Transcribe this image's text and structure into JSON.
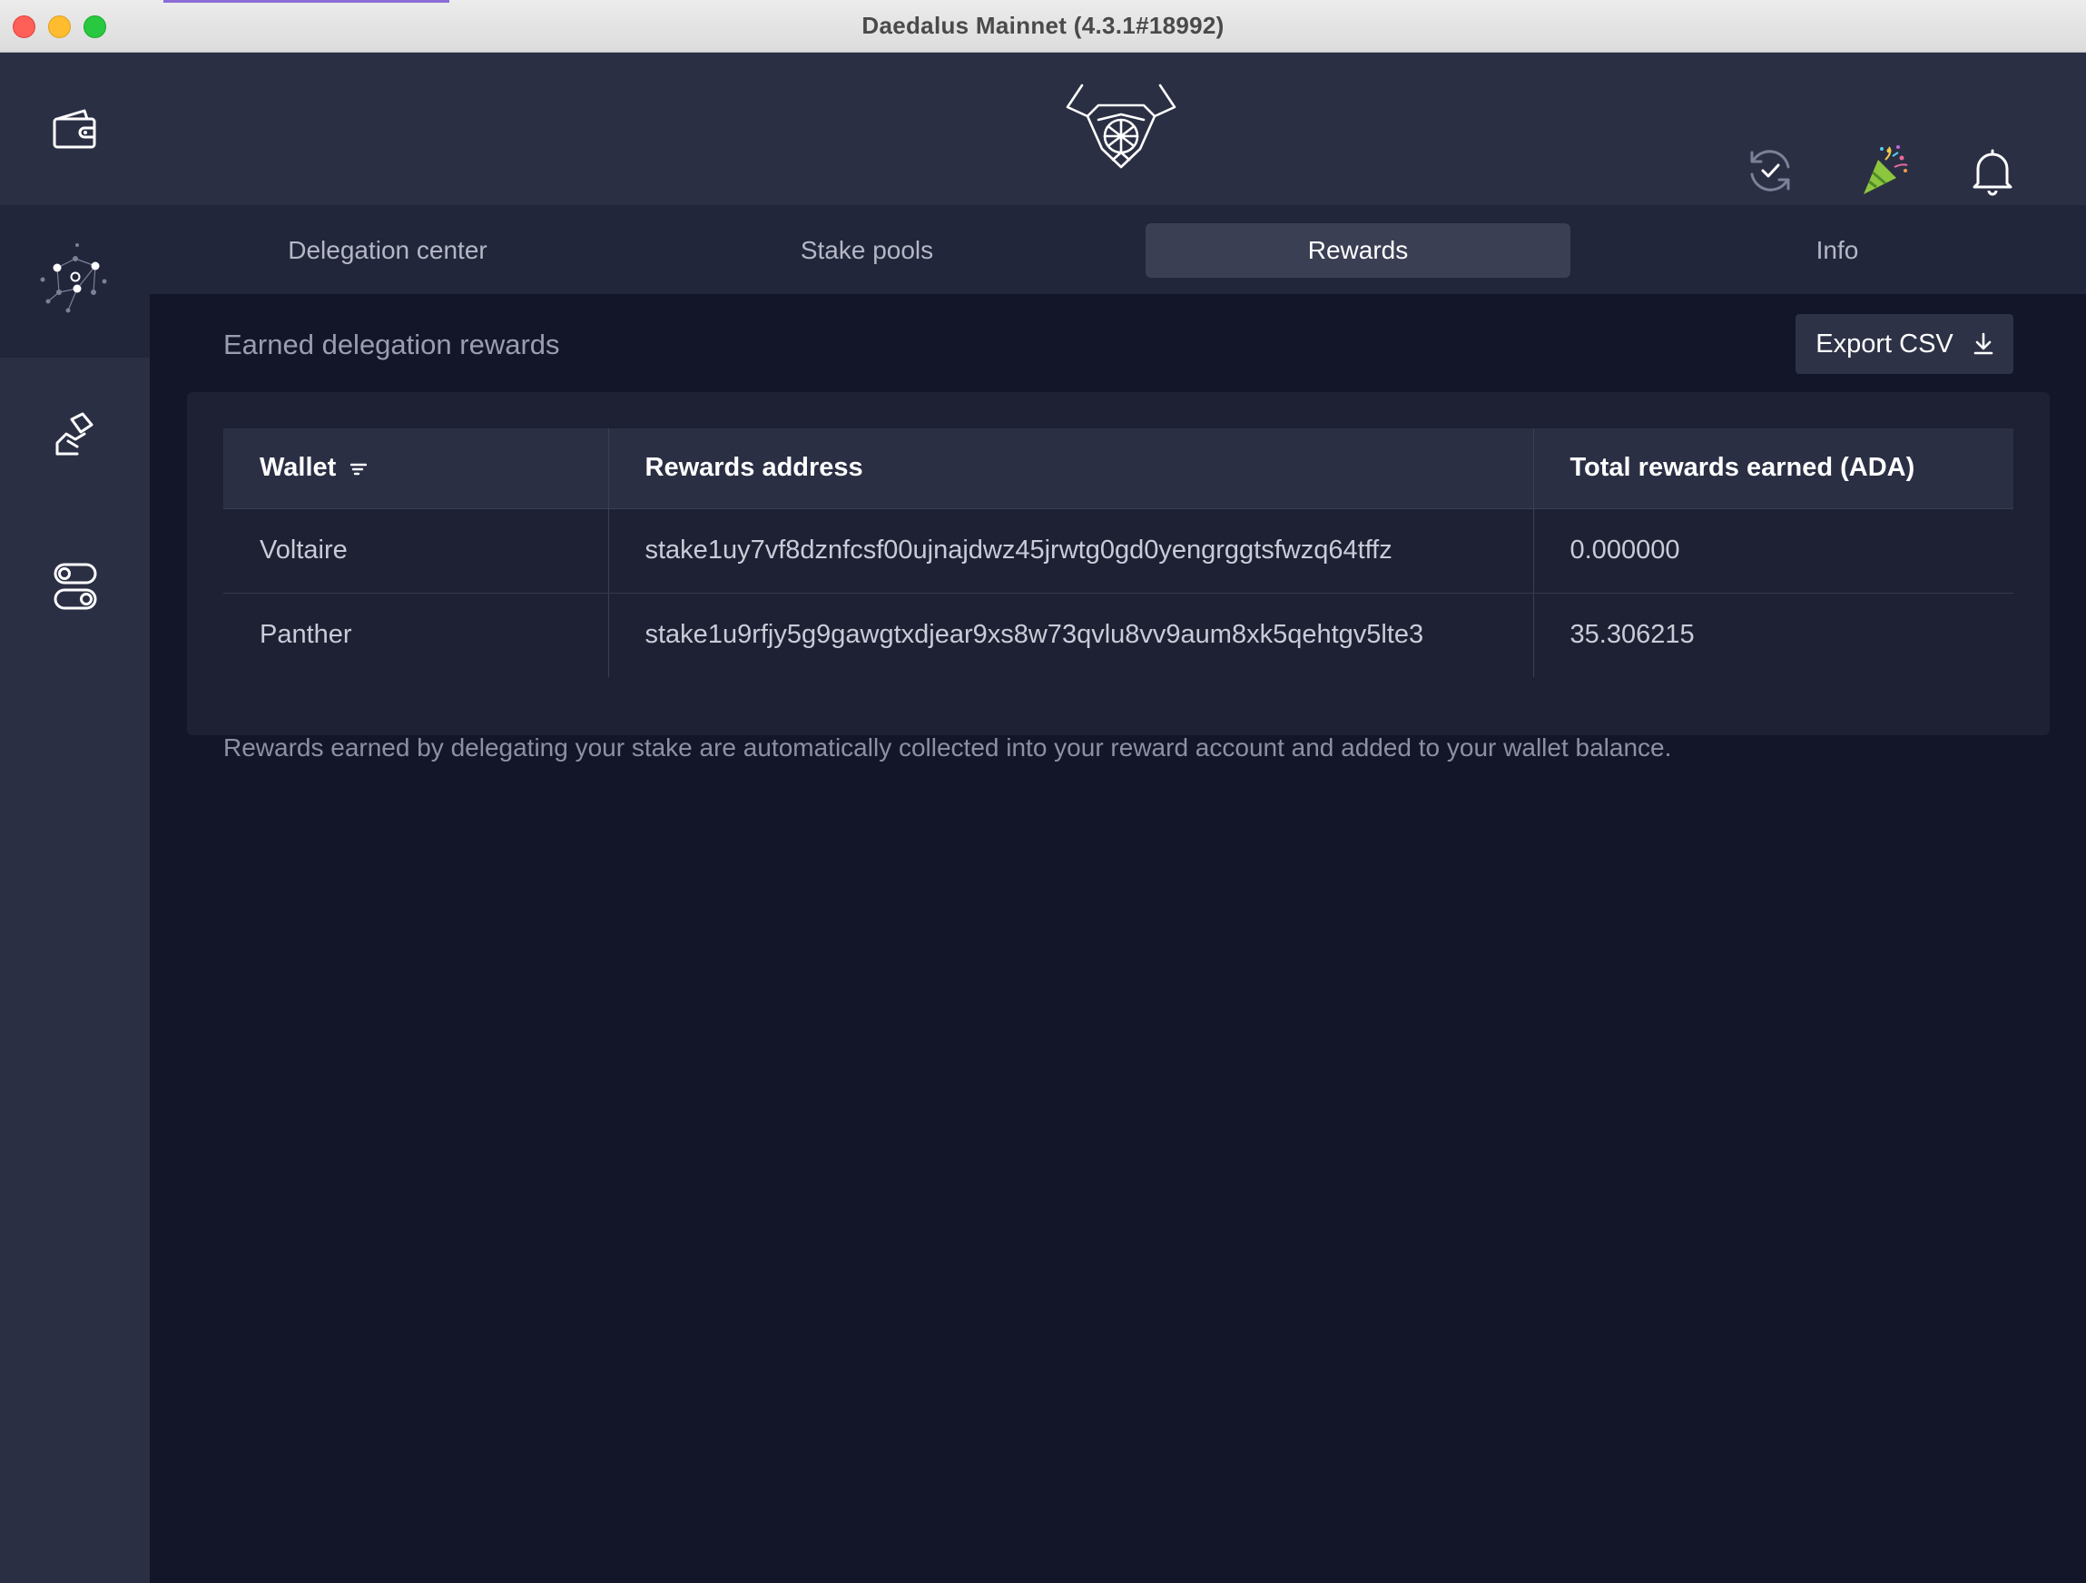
{
  "window": {
    "title": "Daedalus Mainnet (4.3.1#18992)"
  },
  "sidebar": {
    "items": [
      {
        "name": "wallets",
        "icon": "wallet-icon",
        "active": false
      },
      {
        "name": "delegation",
        "icon": "network-nodes-icon",
        "active": true
      },
      {
        "name": "voting",
        "icon": "voting-hand-icon",
        "active": false
      },
      {
        "name": "settings",
        "icon": "toggle-settings-icon",
        "active": false
      }
    ]
  },
  "header": {
    "logo": "daedalus-bull-logo",
    "icons": [
      "sync-check-icon",
      "party-popper-icon",
      "bell-icon"
    ]
  },
  "tabs": [
    {
      "label": "Delegation center",
      "active": false
    },
    {
      "label": "Stake pools",
      "active": false
    },
    {
      "label": "Rewards",
      "active": true
    },
    {
      "label": "Info",
      "active": false
    }
  ],
  "rewards": {
    "title": "Earned delegation rewards",
    "export_label": "Export CSV",
    "columns": {
      "wallet": "Wallet",
      "address": "Rewards address",
      "total": "Total rewards earned (ADA)"
    },
    "rows": [
      {
        "wallet": "Voltaire",
        "address": "stake1uy7vf8dznfcsf00ujnajdwz45jrwtg0gd0yengrggtsfwzq64tffz",
        "total": "0.000000"
      },
      {
        "wallet": "Panther",
        "address": "stake1u9rfjy5g9gawgtxdjear9xs8w73qvlu8vv9aum8xk5qehtgv5lte3",
        "total": "35.306215"
      }
    ],
    "note": "Rewards earned by delegating your stake are automatically collected into your reward account and added to your wallet balance."
  },
  "colors": {
    "background": "#131628",
    "sidebar": "#2b2f44",
    "active_tab": "#3b3f54"
  }
}
